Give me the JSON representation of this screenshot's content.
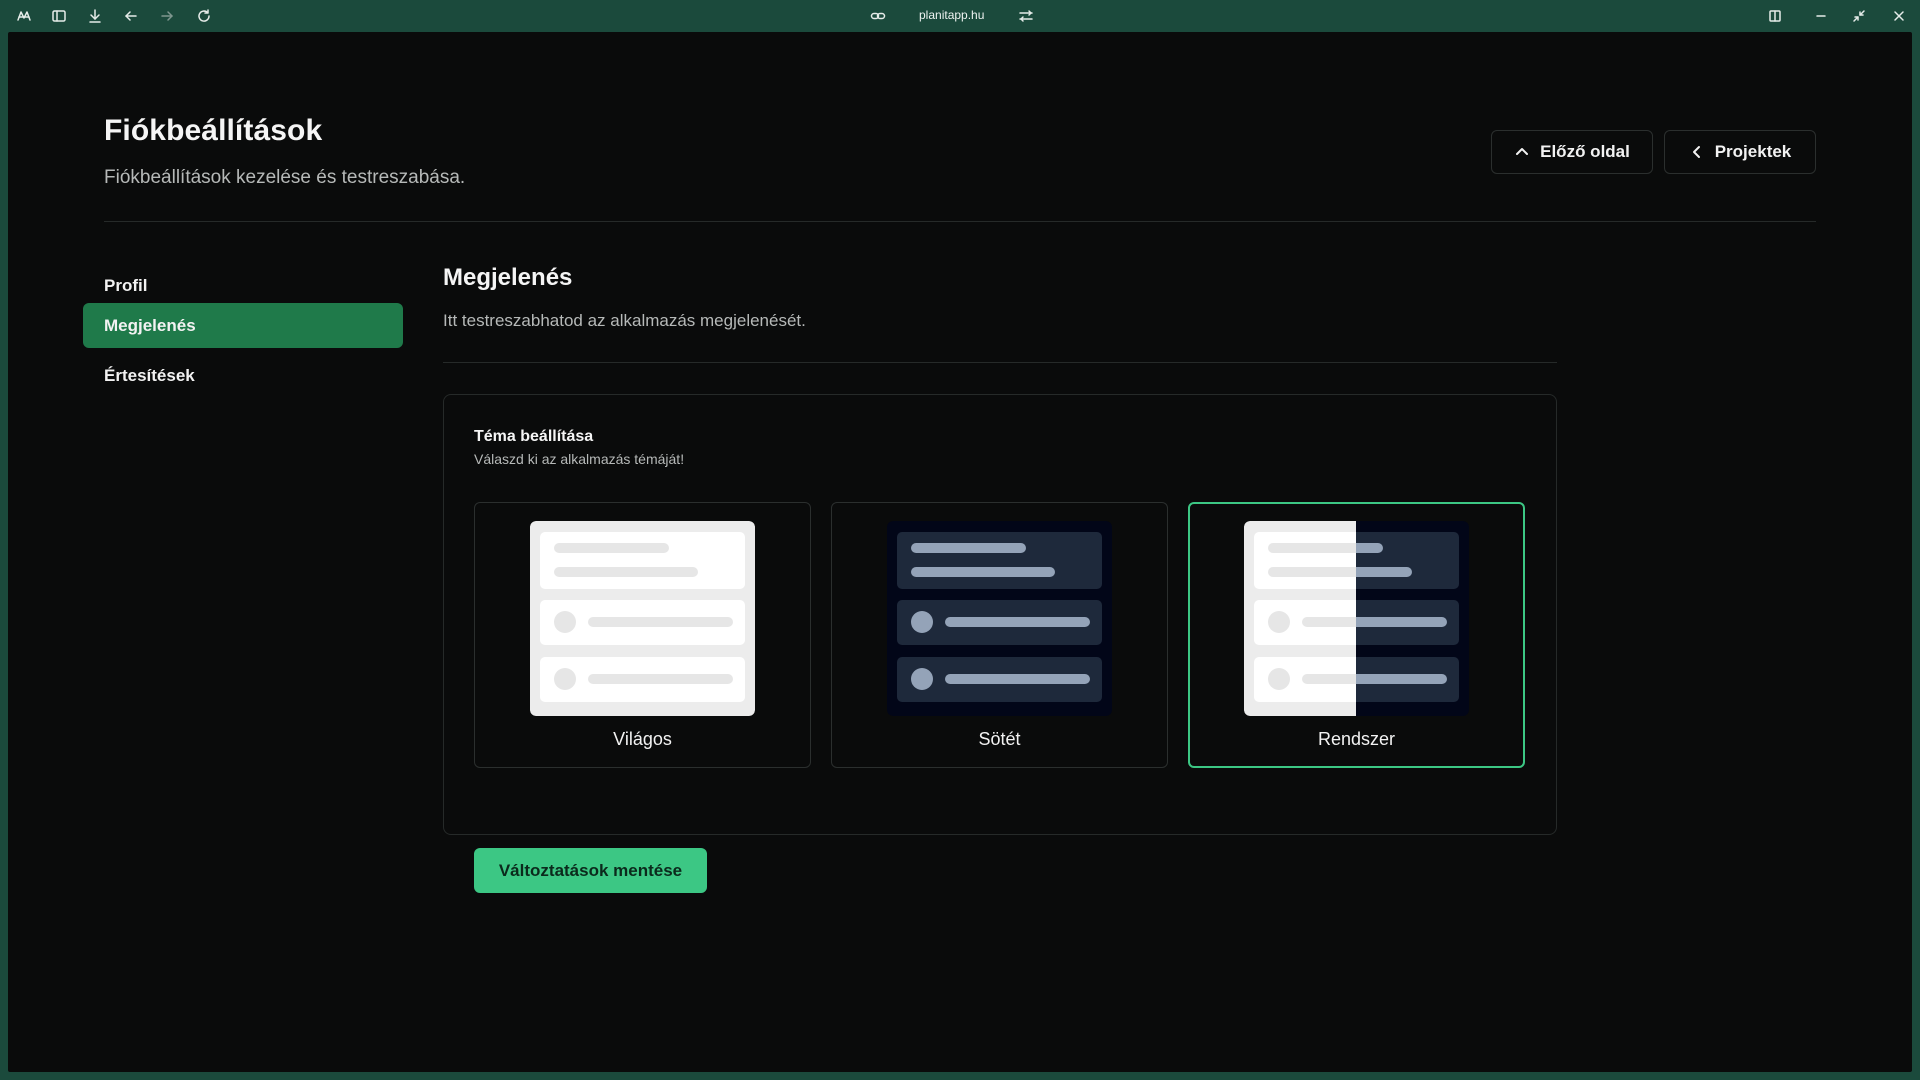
{
  "browser": {
    "url": "planitapp.hu"
  },
  "header": {
    "title": "Fiókbeállítások",
    "subtitle": "Fiókbeállítások kezelése és testreszabása.",
    "prev_button": "Előző oldal",
    "projects_button": "Projektek"
  },
  "sidebar": {
    "items": [
      {
        "label": "Profil",
        "active": false
      },
      {
        "label": "Megjelenés",
        "active": true
      },
      {
        "label": "Értesítések",
        "active": false
      }
    ]
  },
  "section": {
    "title": "Megjelenés",
    "subtitle": "Itt testreszabhatod az alkalmazás megjelenését."
  },
  "theme_card": {
    "title": "Téma beállítása",
    "subtitle": "Válaszd ki az alkalmazás témáját!",
    "options": [
      {
        "label": "Világos",
        "selected": false
      },
      {
        "label": "Sötét",
        "selected": false
      },
      {
        "label": "Rendszer",
        "selected": true
      }
    ],
    "save_button": "Változtatások mentése"
  },
  "colors": {
    "accent": "#3cc784",
    "active_nav": "#1f7a4a",
    "background": "#0a0b0b",
    "chrome": "#1b4a3c"
  }
}
